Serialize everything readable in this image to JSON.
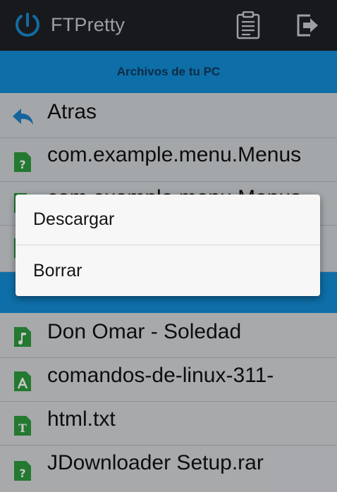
{
  "app": {
    "title": "FTPretty",
    "icons": {
      "logo": "power-logo-icon",
      "clipboard": "clipboard-icon",
      "exit": "exit-icon"
    }
  },
  "colors": {
    "appbar": "#1f2124",
    "section_header": "#138ed6",
    "file_icon_green": "#2e9b3e",
    "dialog": "#f7f7f7"
  },
  "pc_section": {
    "header": "Archivos de tu PC",
    "items": [
      {
        "label": "Atras",
        "icon": "back-arrow-icon"
      },
      {
        "label": "com.example.menu.Menus",
        "icon": "unknown-file-icon"
      },
      {
        "label": "com.example.menu.Menus.",
        "icon": "unknown-file-icon"
      },
      {
        "label": "",
        "icon": "unknown-file-icon"
      }
    ]
  },
  "device_section": {
    "header": "",
    "items": [
      {
        "label": "Don Omar - Soledad",
        "icon": "music-file-icon"
      },
      {
        "label": "comandos-de-linux-311-",
        "icon": "pdf-file-icon"
      },
      {
        "label": "html.txt",
        "icon": "text-file-icon"
      },
      {
        "label": "JDownloader Setup.rar",
        "icon": "unknown-file-icon"
      }
    ]
  },
  "context_menu": {
    "items": [
      {
        "label": "Descargar"
      },
      {
        "label": "Borrar"
      }
    ]
  }
}
